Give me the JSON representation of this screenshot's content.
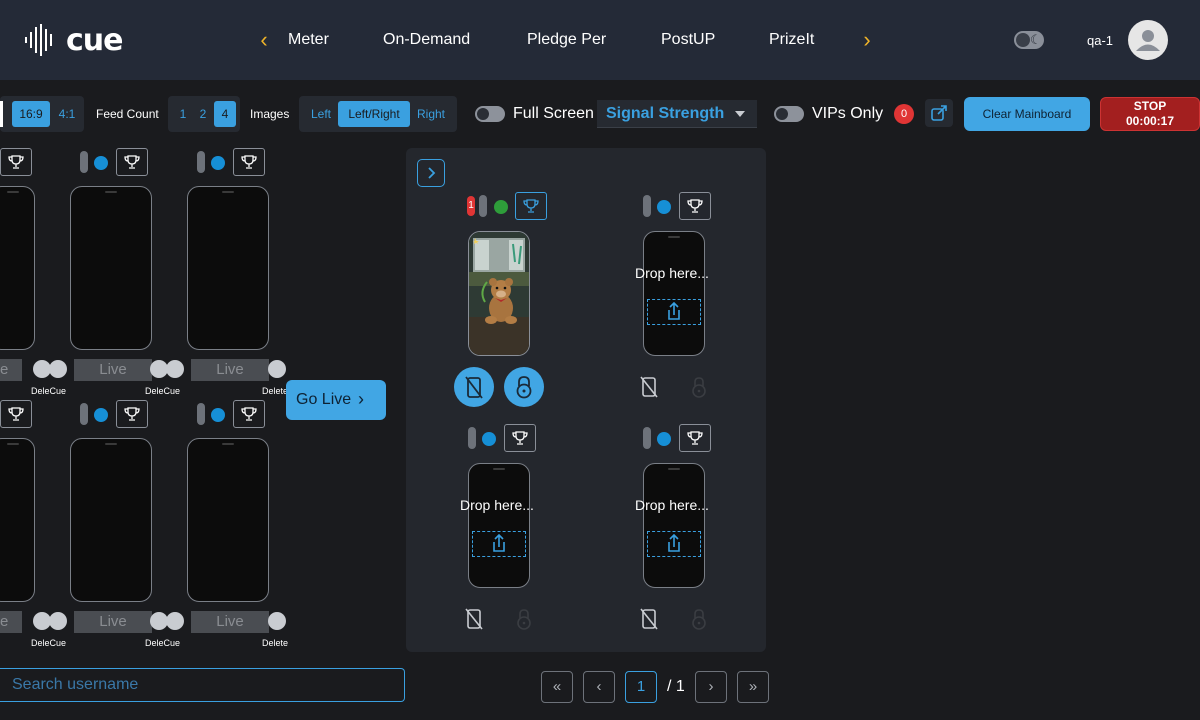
{
  "header": {
    "logo_text": "cue",
    "nav_items": [
      "Meter",
      "On-Demand",
      "Pledge Per",
      "PostUP",
      "PrizeIt"
    ],
    "username": "qa-1"
  },
  "toolbar": {
    "aspect_options": [
      "16:9",
      "4:1"
    ],
    "aspect_selected": "16:9",
    "feed_count_label": "Feed Count",
    "feed_count_options": [
      "1",
      "2",
      "4"
    ],
    "feed_count_selected": "4",
    "images_label": "Images",
    "image_options": [
      "Left",
      "Left/Right",
      "Right"
    ],
    "image_selected": "Left/Right",
    "full_screen_label": "Full Screen",
    "signal_select_value": "Signal Strength",
    "vips_only_label": "VIPs Only",
    "vip_count": "0",
    "clear_button_label": "Clear Mainboard",
    "stop_label": "STOP",
    "stop_timer": "00:00:17"
  },
  "feed_grid": {
    "live_label": "Live",
    "partial_live_label": "e",
    "delete_label": "Delete",
    "cue_label": "Cue",
    "delete_cue_overlap": "DeleCue"
  },
  "go_live_label": "Go Live",
  "mainboard": {
    "slot_badge": "1",
    "drop_text": "Drop here...",
    "colors": {
      "accent": "#41a6e4",
      "green": "#2e9d3a",
      "blue": "#168fd6",
      "red": "#e03535"
    }
  },
  "search": {
    "placeholder": "Search username"
  },
  "pagination": {
    "current": "1",
    "total_text": "/ 1"
  }
}
